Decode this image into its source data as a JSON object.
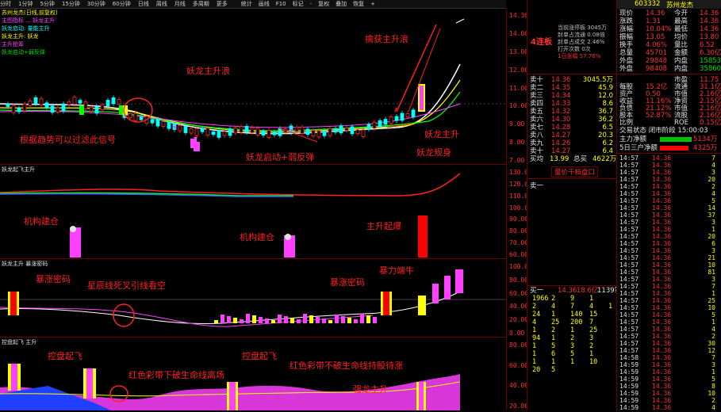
{
  "toolbar": {
    "items": [
      "分时",
      "1分钟",
      "5分钟",
      "15分钟",
      "30分钟",
      "60分钟",
      "日线",
      "周线",
      "月线",
      "多周期",
      "更多"
    ],
    "right_items": [
      "统计",
      "画线",
      "F10",
      "标记",
      "-",
      "复权",
      "叠加",
      "恢复",
      "+"
    ]
  },
  "chart": {
    "main_title": "苏州龙杰(日线,前复权)",
    "main_indicators": "主图指标 ... 妖龙主升",
    "legend_lines": [
      "妖龙启动: 量能主升",
      "妖龙主升: 妖龙",
      "主升抢筹",
      "妖龙启动+弱反弹"
    ],
    "panel2_title": "妖龙起飞主升",
    "panel3_title": "妖龙主升 暴涨密码",
    "panel4_title": "控盘起飞 主升"
  },
  "annotations": {
    "main_uptrend": "妖龙主升浪",
    "capture_uptrend": "擒获主升浪",
    "trend_filter": "根据趋势可以过滤此信号",
    "dragon_start": "妖龙启动+弱反弹",
    "dragon_main": "妖龙主升",
    "dragon_shape": "妖龙规身",
    "inst_build_1": "机构建仓",
    "inst_build_2": "机构建仓",
    "rise_start": "主升起爆",
    "surge_code_1": "暴涨密码",
    "surge_code_2": "暴涨密码",
    "star_line": "星辰线死叉引线看空",
    "force_bull": "暴力端牛",
    "control_1": "控盘起飞",
    "control_2": "控盘起飞",
    "red_break": "红色彩带下破生命线离场",
    "red_hold": "红色彩带不破生命线持股待涨",
    "strong_up": "强龙主升"
  },
  "axes": {
    "main": [
      "14.36",
      "14.00",
      "13.00",
      "12.00",
      "11.00",
      "10.00",
      "9.00",
      "8.00",
      "7.00"
    ],
    "p2": [
      "130.00",
      "120.00",
      "110.00",
      "100.00",
      "90.00",
      "80.00",
      "70.00",
      "60.00"
    ],
    "p3": [
      "100.00",
      "80.00",
      "60.00",
      "40.00",
      "20.00",
      "0.00"
    ],
    "p4": [
      "80.00",
      "60.00",
      "40.00",
      "20.00"
    ]
  },
  "mid": {
    "badge": "4连板",
    "info_lines": [
      "当前涨停板 3045万",
      "封单占流通 0.08倍",
      "封单占成交 2.46%",
      "打开次数 0次",
      "1日涨幅 57.76%"
    ],
    "sell_rows": [
      {
        "label": "卖十",
        "price": "14.36",
        "vol": "3045.5万"
      },
      {
        "label": "卖二",
        "price": "14.35",
        "vol": "45.9"
      },
      {
        "label": "卖三",
        "price": "14.34",
        "vol": "12.0"
      },
      {
        "label": "卖四",
        "price": "14.33",
        "vol": "8.6"
      },
      {
        "label": "卖五",
        "price": "14.32",
        "vol": "36.7"
      },
      {
        "label": "卖六",
        "price": "14.30",
        "vol": "36.2"
      },
      {
        "label": "卖七",
        "price": "14.28",
        "vol": "6.5"
      },
      {
        "label": "卖八",
        "price": "14.27",
        "vol": "20.3"
      },
      {
        "label": "卖九",
        "price": "14.26",
        "vol": "6.2"
      },
      {
        "label": "卖十",
        "price": "14.27",
        "vol": "6.4"
      }
    ],
    "buy_label": "买均",
    "buy_price": "13.99",
    "buy_sum": "总买",
    "buy_vol": "4622万",
    "order_btn": "量价千档盘口",
    "sell1_label": "卖一",
    "book_head": [
      "买一",
      "14.36",
      "18.6亿",
      "1139笔"
    ],
    "book": [
      [
        "1966",
        "2",
        "9",
        "1"
      ],
      [
        "2",
        "4",
        "7",
        "4",
        "1"
      ],
      [
        "24",
        "1",
        "140",
        "15"
      ],
      [
        "4",
        "25",
        "200",
        "7"
      ],
      [
        "1",
        "2",
        "1",
        "25"
      ],
      [
        "94",
        "1",
        "2",
        "3"
      ],
      [
        "1",
        "5",
        "3",
        "2"
      ],
      [
        "1",
        "6",
        "5",
        "1"
      ],
      [
        "1",
        "1",
        "1",
        "10"
      ],
      [
        "20",
        "5",
        ""
      ]
    ]
  },
  "right": {
    "code": "603332",
    "name": "苏州龙杰",
    "quote": [
      [
        "现价",
        "14.36",
        "今开",
        "14.36"
      ],
      [
        "涨跌",
        "1.31",
        "最高",
        "14.36"
      ],
      [
        "涨幅",
        "10.04%",
        "最低",
        "14.36"
      ],
      [
        "振幅",
        "13.05",
        "均价",
        "13.80"
      ],
      [
        "换手",
        "4.06%",
        "量比",
        "6.52"
      ],
      [
        "总量",
        "45701",
        "金额",
        "6.30亿"
      ],
      [
        "外盘",
        "29848",
        "内盘",
        "15853"
      ],
      [
        "外盘",
        "98408",
        "内盘",
        "358604"
      ]
    ],
    "fin": [
      [
        "市盈",
        "11.75"
      ],
      [
        "每股",
        "15.2亿",
        "流通",
        "31.1亿"
      ],
      [
        "资产",
        "0.50",
        "市值",
        "2.16亿"
      ],
      [
        "收益",
        "11.16%",
        "净资",
        "2.15亿"
      ],
      [
        "负债",
        "21.12%",
        "市值",
        "2.16亿"
      ],
      [
        "股本",
        "52.87%",
        "流股",
        "2.16亿"
      ],
      [
        "比例",
        "",
        "ROE",
        "0.15亿"
      ]
    ],
    "time_line": "交易状态  闭市阶段  15:00:03",
    "flow": [
      {
        "label": "主力净额",
        "val": "5134万"
      },
      {
        "label": "5日三户净额",
        "val": "4325万"
      }
    ],
    "ticks": [
      [
        "14:57",
        "14.36",
        "7"
      ],
      [
        "14:57",
        "14.36",
        "4"
      ],
      [
        "14:57",
        "14.36",
        "3"
      ],
      [
        "14:57",
        "14.36",
        "20"
      ],
      [
        "14:57",
        "14.36",
        "2"
      ],
      [
        "14:57",
        "14.36",
        "4"
      ],
      [
        "14:57",
        "14.36",
        "5"
      ],
      [
        "14:57",
        "14.36",
        "14"
      ],
      [
        "14:57",
        "14.36",
        "37"
      ],
      [
        "14:57",
        "14.36",
        "3"
      ],
      [
        "14:57",
        "14.36",
        "1"
      ],
      [
        "14:57",
        "14.36",
        "20"
      ],
      [
        "14:57",
        "14.36",
        "6"
      ],
      [
        "14:57",
        "14.36",
        "3"
      ],
      [
        "14:57",
        "14.36",
        "21"
      ],
      [
        "14:57",
        "14.36",
        "10"
      ],
      [
        "14:57",
        "14.36",
        "81"
      ],
      [
        "14:57",
        "14.36",
        "3"
      ],
      [
        "14:57",
        "14.36",
        "7"
      ],
      [
        "14:57",
        "14.36",
        "1"
      ],
      [
        "14:57",
        "14.36",
        "25"
      ],
      [
        "14:57",
        "14.36",
        "10"
      ],
      [
        "14:57",
        "14.36",
        "5"
      ],
      [
        "14:57",
        "14.36",
        "1"
      ],
      [
        "14:57",
        "14.36",
        "4"
      ],
      [
        "14:57",
        "14.36",
        "2"
      ],
      [
        "14:57",
        "14.36",
        "30"
      ],
      [
        "14:57",
        "14.36",
        "12"
      ],
      [
        "14:58",
        "14.36",
        "7"
      ],
      [
        "14:59",
        "14.36",
        "3"
      ],
      [
        "14:59",
        "14.36",
        "1"
      ],
      [
        "14:59",
        "14.36",
        "5"
      ],
      [
        "14:59",
        "14.36",
        "8"
      ],
      [
        "14:59",
        "14.36",
        "10"
      ],
      [
        "14:59",
        "14.36",
        "2"
      ],
      [
        "14:59",
        "14.36",
        "4"
      ]
    ]
  }
}
